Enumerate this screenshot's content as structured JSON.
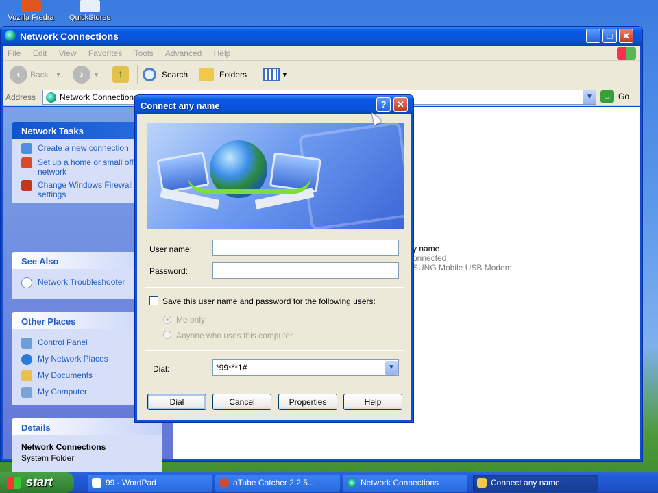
{
  "desktop": {
    "icons": [
      {
        "label": "Vozilla Fredra"
      },
      {
        "label": "QuickStores"
      }
    ]
  },
  "window": {
    "title": "Network Connections",
    "menu": [
      "File",
      "Edit",
      "View",
      "Favorites",
      "Tools",
      "Advanced",
      "Help"
    ],
    "toolbar": {
      "back": "Back",
      "search": "Search",
      "folders": "Folders"
    },
    "address": {
      "label": "Address",
      "value": "Network Connections",
      "go": "Go"
    }
  },
  "left_pane": {
    "network_tasks": {
      "title": "Network Tasks",
      "items": [
        {
          "label": "Create a new connection"
        },
        {
          "label": "Set up a home or small office network"
        },
        {
          "label": "Change Windows Firewall settings"
        }
      ]
    },
    "see_also": {
      "title": "See Also",
      "items": [
        {
          "label": "Network Troubleshooter"
        }
      ]
    },
    "other_places": {
      "title": "Other Places",
      "items": [
        {
          "label": "Control Panel"
        },
        {
          "label": "My Network Places"
        },
        {
          "label": "My Documents"
        },
        {
          "label": "My Computer"
        }
      ]
    },
    "details": {
      "title": "Details",
      "name": "Network Connections",
      "type": "System Folder"
    }
  },
  "right_pane": {
    "connection": {
      "name": "y name",
      "status": "onnected",
      "device": "SUNG Mobile USB Modem"
    }
  },
  "dialog": {
    "title": "Connect any name",
    "help_glyph": "?",
    "close_glyph": "✕",
    "username_label": "User name:",
    "username_value": "",
    "password_label": "Password:",
    "password_value": "",
    "save_label": "Save this user name and password for the following users:",
    "radio_me": "Me only",
    "radio_anyone": "Anyone who uses this computer",
    "dial_label": "Dial:",
    "dial_value": "*99***1#",
    "buttons": {
      "dial": "Dial",
      "cancel": "Cancel",
      "properties": "Properties",
      "help": "Help"
    }
  },
  "taskbar": {
    "start": "start",
    "tasks": [
      {
        "label": "99 - WordPad"
      },
      {
        "label": "aTube Catcher 2.2.5..."
      },
      {
        "label": "Network Connections"
      },
      {
        "label": "Connect any name"
      }
    ]
  },
  "colors": {
    "titlebar_blue": "#0a52d8",
    "link_blue": "#215dc6",
    "start_green": "#3c8f3c"
  }
}
